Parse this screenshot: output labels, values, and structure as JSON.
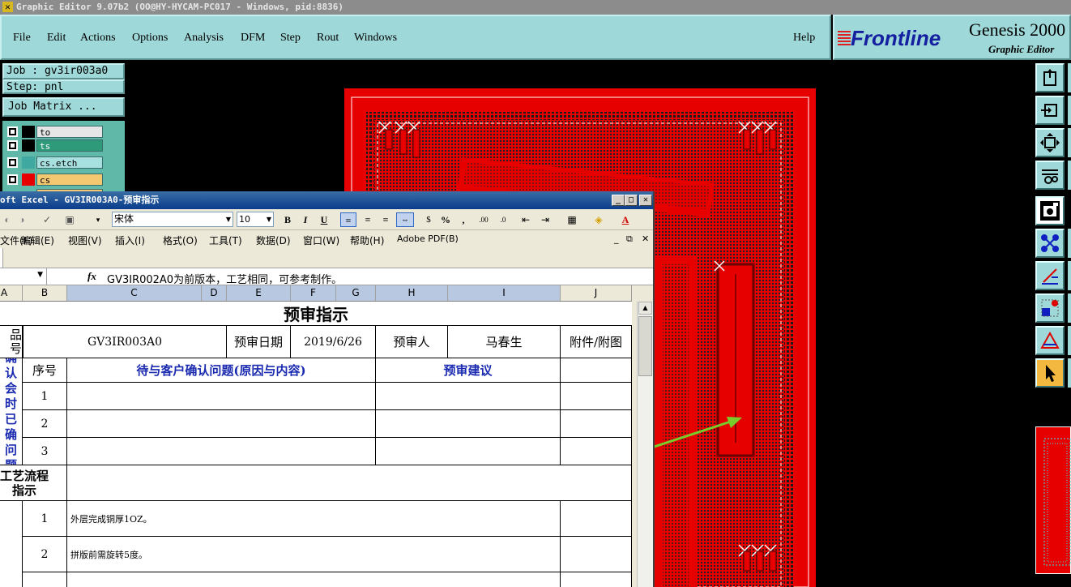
{
  "genesis": {
    "title": "Graphic Editor 9.07b2 (OO@HY-HYCAM-PC017 - Windows, pid:8836)",
    "menu": [
      "File",
      "Edit",
      "Actions",
      "Options",
      "Analysis",
      "DFM",
      "Step",
      "Rout",
      "Windows"
    ],
    "help": "Help",
    "logo_frontline": "Frontline",
    "logo_genesis": "Genesis 2000",
    "logo_subtitle": "Graphic Editor",
    "job": "Job : gv3ir003a0",
    "step": "Step: pnl",
    "job_matrix": "Job Matrix ...",
    "layers": [
      {
        "name": "to",
        "color": "#e6e6e6"
      },
      {
        "name": "ts",
        "color": "#2f9a7a"
      },
      {
        "name": "cs.etch",
        "color": "#3fa8a0"
      },
      {
        "name": "cs",
        "color": "#e60000"
      }
    ],
    "tools": [
      "export-icon",
      "import-icon",
      "fit-view-icon",
      "tools-icon",
      "snapshot-icon",
      "net-icon",
      "measure-icon",
      "feature-select-icon",
      "drc-icon",
      "pointer-icon"
    ],
    "colors": {
      "board": "#e60000",
      "panel_bg": "#9fd8d8",
      "arrow": "#7acc2a"
    }
  },
  "excel": {
    "title": "oft Excel - GV3IR003A0-预审指示",
    "font": "宋体",
    "font_size": "10",
    "menu": [
      "文件(F)",
      "编辑(E)",
      "视图(V)",
      "插入(I)",
      "格式(O)",
      "工具(T)",
      "数据(D)",
      "窗口(W)",
      "帮助(H)",
      "Adobe PDF(B)"
    ],
    "formula": "GV3IR002A0为前版本，工艺相同，可参考制作。",
    "fx": "fx",
    "columns": [
      "A",
      "B",
      "C",
      "D",
      "E",
      "F",
      "G",
      "H",
      "I",
      "J"
    ],
    "sheet": {
      "title": "预审指示",
      "product_label": "品\n号",
      "product_value": "GV3IR003A0",
      "date_label": "预审日期",
      "date_value": "2019/6/26",
      "reviewer_label": "预审人",
      "reviewer_value": "马春生",
      "attachment_label": "附件/附图",
      "seq_header": "序号",
      "issue_header": "待与客户确认问题(原因与内容)",
      "suggest_header": "预审建议",
      "confirm_label": "确认\n会时\n已确\n问题",
      "rows": [
        "1",
        "2",
        "3"
      ],
      "process_label": "工艺流程\n指示",
      "process_rows": [
        {
          "seq": "1",
          "text": "外层完成铜厚1OZ。"
        },
        {
          "seq": "2",
          "text": "拼版前需旋转5度。"
        }
      ]
    }
  }
}
